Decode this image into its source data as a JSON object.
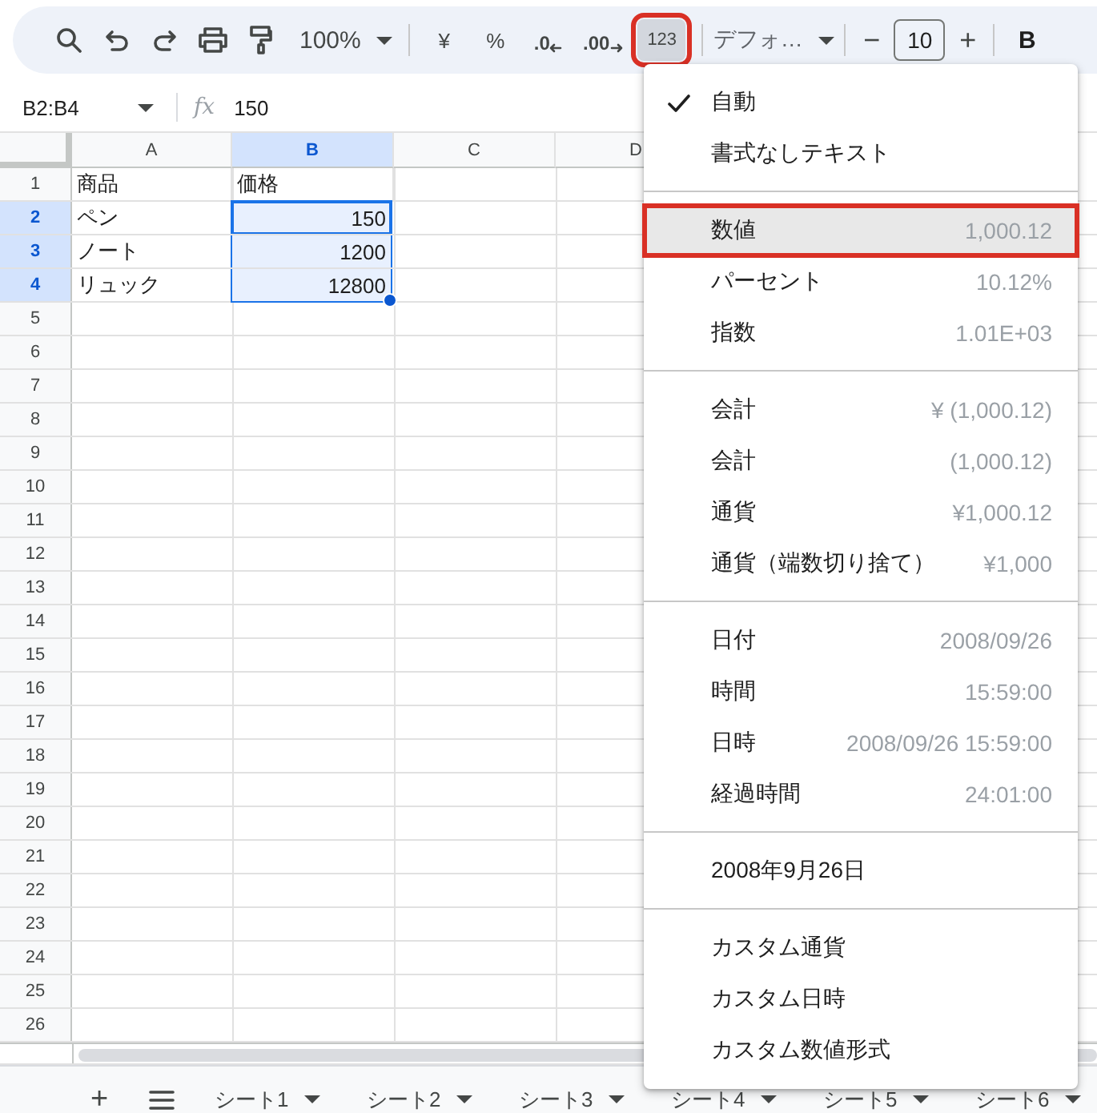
{
  "toolbar": {
    "zoom": "100%",
    "currency": "¥",
    "percent": "%",
    "decrease_decimal": ".0",
    "increase_decimal": ".00",
    "number_format": {
      "label": "123",
      "selected": true,
      "annotated": true
    },
    "font": "デフォ…",
    "font_size_decrease": "−",
    "font_size": "10",
    "font_size_increase": "+",
    "bold": "B"
  },
  "formula_bar": {
    "name_box": "B2:B4",
    "fx": "fx",
    "formula": "150"
  },
  "columns": [
    {
      "label": "A",
      "selected": false
    },
    {
      "label": "B",
      "selected": true
    },
    {
      "label": "C",
      "selected": false
    },
    {
      "label": "D",
      "selected": false
    }
  ],
  "rows": [
    {
      "header": "1",
      "selected": false,
      "cells": [
        {
          "text": "商品",
          "kind": "text",
          "selected": false
        },
        {
          "text": "価格",
          "kind": "text",
          "selected": false
        }
      ]
    },
    {
      "header": "2",
      "selected": true,
      "cells": [
        {
          "text": "ペン",
          "kind": "text",
          "selected": false
        },
        {
          "text": "150",
          "kind": "number",
          "selected": true
        }
      ]
    },
    {
      "header": "3",
      "selected": true,
      "cells": [
        {
          "text": "ノート",
          "kind": "text",
          "selected": false
        },
        {
          "text": "1200",
          "kind": "number",
          "selected": true
        }
      ]
    },
    {
      "header": "4",
      "selected": true,
      "cells": [
        {
          "text": "リュック",
          "kind": "text",
          "selected": false
        },
        {
          "text": "12800",
          "kind": "number",
          "selected": true
        }
      ]
    },
    {
      "header": "5",
      "selected": false
    },
    {
      "header": "6",
      "selected": false
    },
    {
      "header": "7",
      "selected": false
    },
    {
      "header": "8",
      "selected": false
    },
    {
      "header": "9",
      "selected": false
    },
    {
      "header": "10",
      "selected": false
    },
    {
      "header": "11",
      "selected": false
    },
    {
      "header": "12",
      "selected": false
    },
    {
      "header": "13",
      "selected": false
    },
    {
      "header": "14",
      "selected": false
    },
    {
      "header": "15",
      "selected": false
    },
    {
      "header": "16",
      "selected": false
    },
    {
      "header": "17",
      "selected": false
    },
    {
      "header": "18",
      "selected": false
    },
    {
      "header": "19",
      "selected": false
    },
    {
      "header": "20",
      "selected": false
    },
    {
      "header": "21",
      "selected": false
    },
    {
      "header": "22",
      "selected": false
    },
    {
      "header": "23",
      "selected": false
    },
    {
      "header": "24",
      "selected": false
    },
    {
      "header": "25",
      "selected": false
    },
    {
      "header": "26",
      "selected": false
    }
  ],
  "format_menu": [
    {
      "kind": "item",
      "label": "自動",
      "checked": true,
      "selected": false,
      "annotated": false
    },
    {
      "kind": "item",
      "label": "書式なしテキスト",
      "checked": false,
      "selected": false,
      "annotated": false
    },
    {
      "kind": "separator"
    },
    {
      "kind": "item",
      "label": "数値",
      "example": "1,000.12",
      "checked": false,
      "selected": true,
      "annotated": true
    },
    {
      "kind": "item",
      "label": "パーセント",
      "example": "10.12%",
      "checked": false,
      "selected": false,
      "annotated": false
    },
    {
      "kind": "item",
      "label": "指数",
      "example": "1.01E+03",
      "checked": false,
      "selected": false,
      "annotated": false
    },
    {
      "kind": "separator"
    },
    {
      "kind": "item",
      "label": "会計",
      "example": "¥ (1,000.12)",
      "checked": false,
      "selected": false,
      "annotated": false
    },
    {
      "kind": "item",
      "label": "会計",
      "example": "(1,000.12)",
      "checked": false,
      "selected": false,
      "annotated": false
    },
    {
      "kind": "item",
      "label": "通貨",
      "example": "¥1,000.12",
      "checked": false,
      "selected": false,
      "annotated": false
    },
    {
      "kind": "item",
      "label": "通貨（端数切り捨て）",
      "example": "¥1,000",
      "checked": false,
      "selected": false,
      "annotated": false
    },
    {
      "kind": "separator"
    },
    {
      "kind": "item",
      "label": "日付",
      "example": "2008/09/26",
      "checked": false,
      "selected": false,
      "annotated": false
    },
    {
      "kind": "item",
      "label": "時間",
      "example": "15:59:00",
      "checked": false,
      "selected": false,
      "annotated": false
    },
    {
      "kind": "item",
      "label": "日時",
      "example": "2008/09/26 15:59:00",
      "checked": false,
      "selected": false,
      "annotated": false
    },
    {
      "kind": "item",
      "label": "経過時間",
      "example": "24:01:00",
      "checked": false,
      "selected": false,
      "annotated": false
    },
    {
      "kind": "separator"
    },
    {
      "kind": "item",
      "label": "2008年9月26日",
      "checked": false,
      "selected": false,
      "annotated": false
    },
    {
      "kind": "separator"
    },
    {
      "kind": "item",
      "label": "カスタム通貨",
      "checked": false,
      "selected": false,
      "annotated": false
    },
    {
      "kind": "item",
      "label": "カスタム日時",
      "checked": false,
      "selected": false,
      "annotated": false
    },
    {
      "kind": "item",
      "label": "カスタム数値形式",
      "checked": false,
      "selected": false,
      "annotated": false
    }
  ],
  "sheet_bar": {
    "add": "+",
    "tabs": [
      {
        "label": "シート1"
      },
      {
        "label": "シート2"
      },
      {
        "label": "シート3"
      },
      {
        "label": "シート4"
      },
      {
        "label": "シート5"
      },
      {
        "label": "シート6"
      }
    ]
  }
}
